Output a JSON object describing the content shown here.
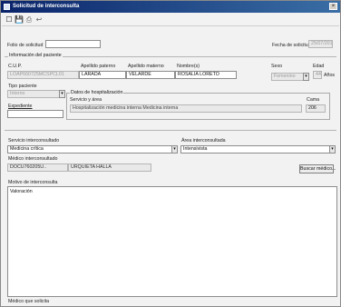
{
  "window": {
    "title": "Solicitud de interconsulta"
  },
  "toolbar": {
    "new": "☐",
    "save": "💾",
    "print": "⎙",
    "exit": "↩"
  },
  "request": {
    "folio_label": "Folio de solicitud",
    "folio_value": "",
    "date_label": "Fecha de solicitud",
    "date_value": "25/07/2011"
  },
  "patient_info": {
    "group_label": "Información del paciente",
    "columns": [
      "C.U.P.",
      "Apellido paterno",
      "Apellido materno",
      "Nombre(s)",
      "Sexo",
      "Edad"
    ],
    "cup": "LOAP660725MCSPCL01",
    "paternal": "LARADA",
    "maternal": "VELARDE",
    "names": "ROSALIA LORETO",
    "sex": "Femenino",
    "age_value": "44",
    "age_unit": "Años",
    "patient_type_label": "Tipo paciente",
    "patient_type_value": "Interno",
    "record_label": "Expediente",
    "record_value": ""
  },
  "hospitalization": {
    "group_label": "Datos de hospitalización",
    "service_label": "Servicio y área",
    "bed_label": "Cama",
    "service_value": "Hospitalización medicina interna   Medicina interna",
    "bed_value": "206"
  },
  "interconsult": {
    "service_label": "Servicio interconsultado",
    "area_label": "Área interconsultada",
    "service_value": "Medicina crítica",
    "area_value": "Intensivista",
    "doctor_label": "Médico interconsultado",
    "doctor_code": "DOCU760205U..",
    "doctor_name": "URQUIETA HALLA",
    "search_button": "Buscar médico...",
    "reason_label": "Motivo de interconsulta",
    "reason_value": "Valoración",
    "requester_label": "Médico que solicita"
  }
}
